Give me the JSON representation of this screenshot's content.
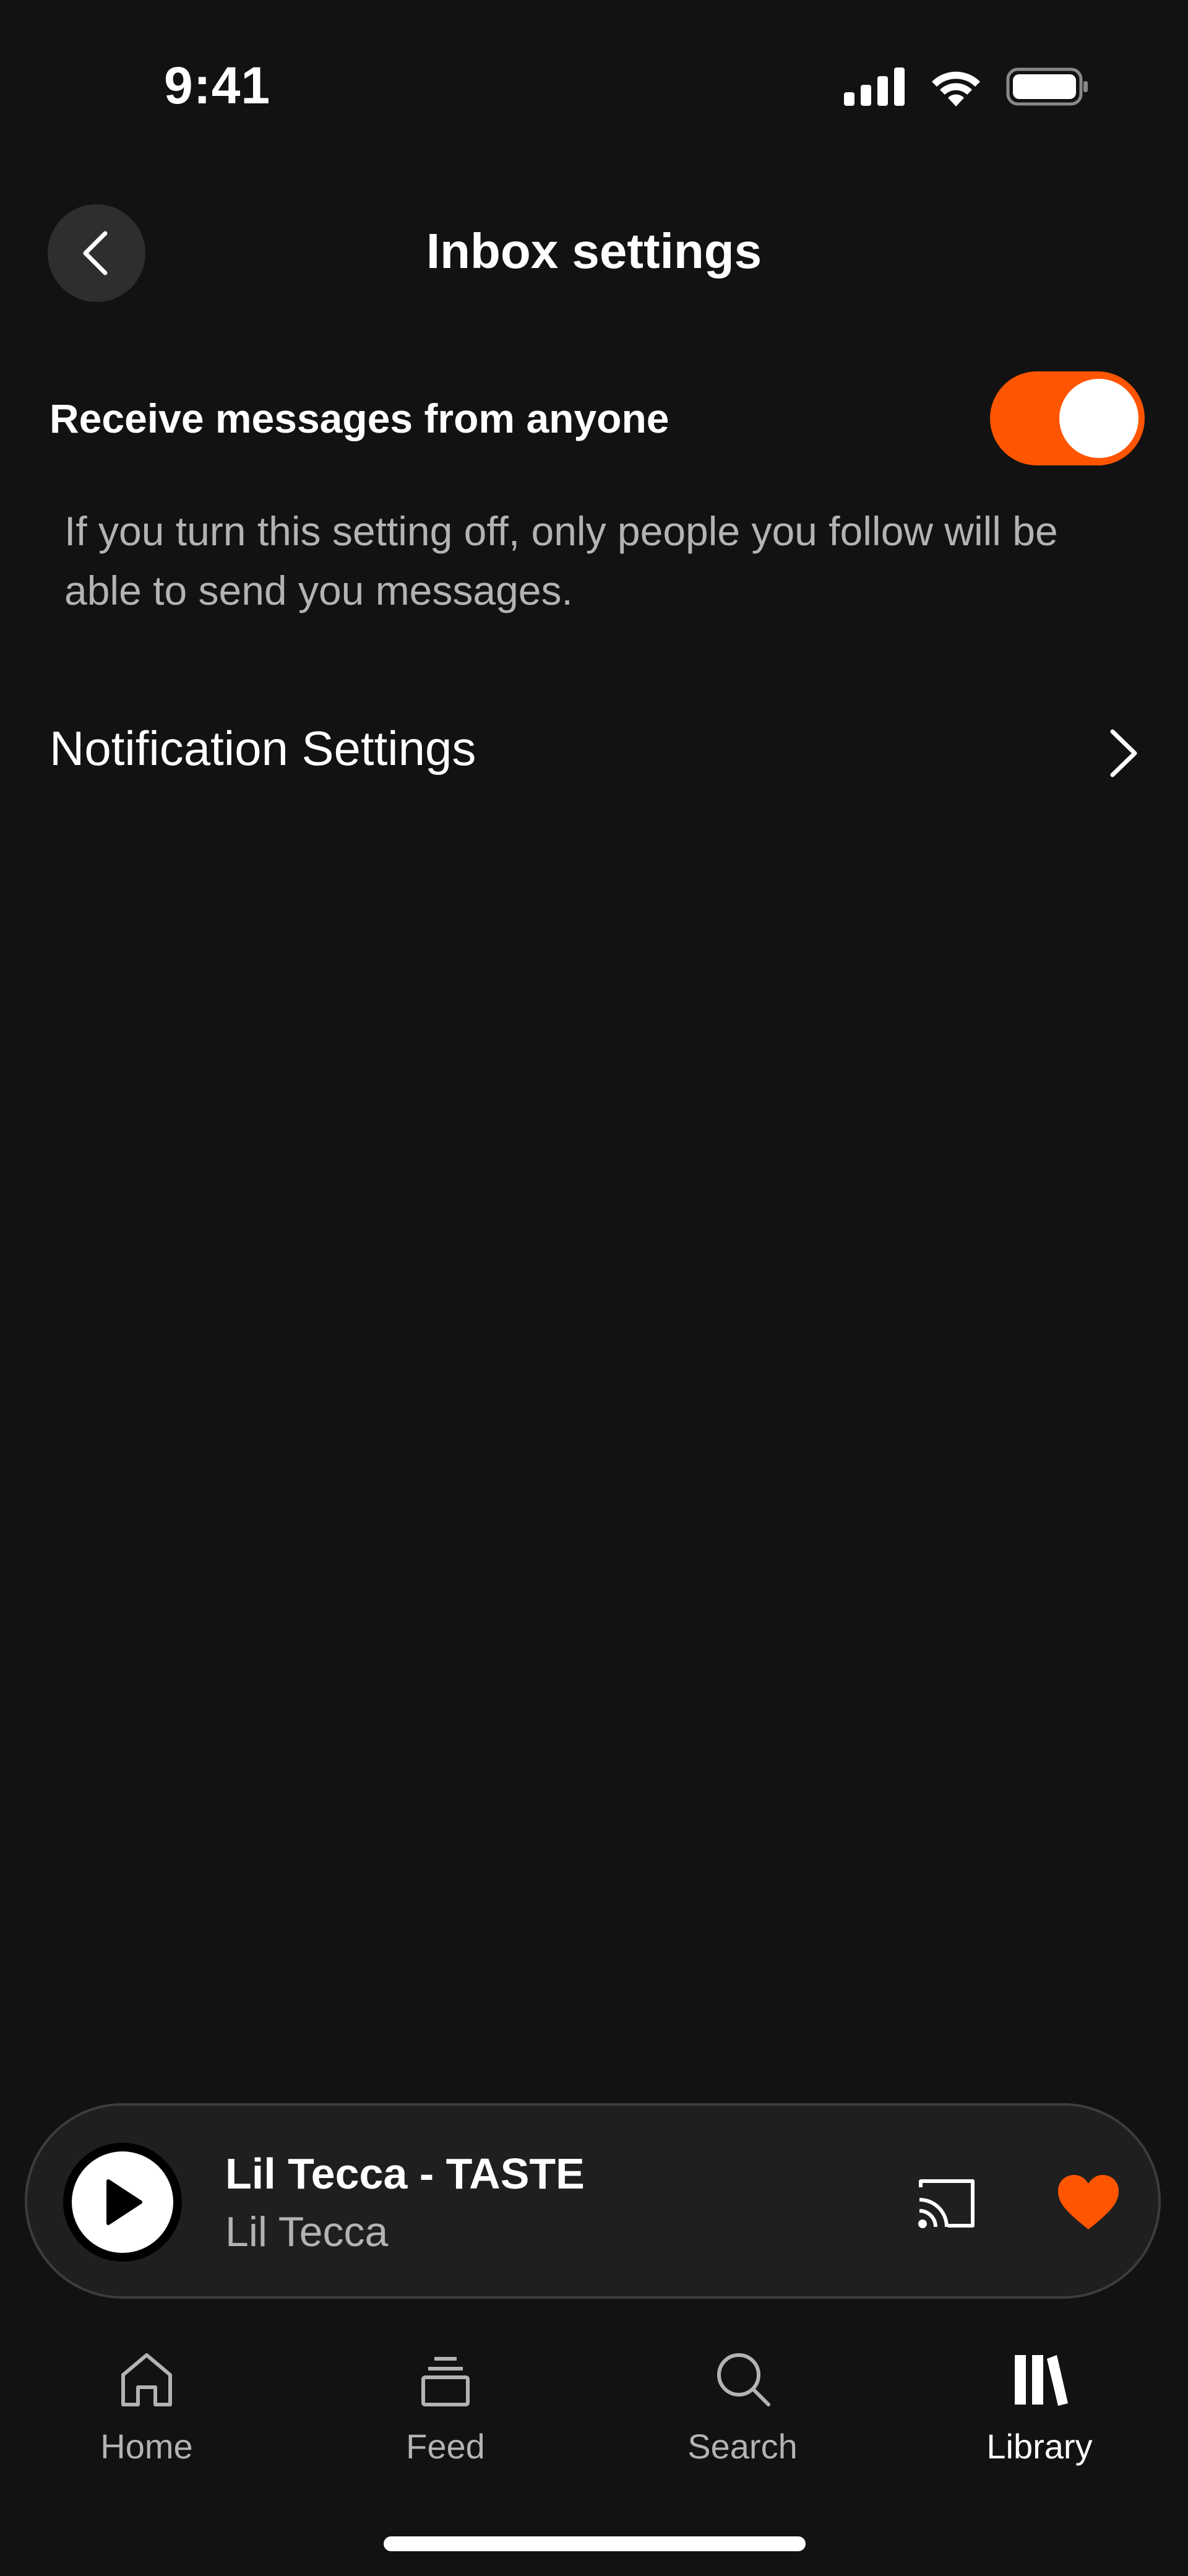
{
  "status_bar": {
    "time": "9:41",
    "icons": [
      "cellular-signal-icon",
      "wifi-icon",
      "battery-icon"
    ]
  },
  "header": {
    "title": "Inbox settings",
    "back_icon": "chevron-left-icon"
  },
  "settings": {
    "receive_messages": {
      "label": "Receive messages from anyone",
      "enabled": true,
      "description": "If you turn this setting off, only people you follow will be able to send you messages."
    },
    "notification_settings": {
      "label": "Notification Settings",
      "icon": "chevron-right-icon"
    }
  },
  "mini_player": {
    "track": "Lil Tecca - TASTE",
    "artist": "Lil Tecca",
    "icons": [
      "play-icon",
      "cast-icon",
      "heart-icon"
    ]
  },
  "tab_bar": {
    "tabs": [
      {
        "label": "Home",
        "icon": "home-icon",
        "active": false
      },
      {
        "label": "Feed",
        "icon": "feed-icon",
        "active": false
      },
      {
        "label": "Search",
        "icon": "search-icon",
        "active": false
      },
      {
        "label": "Library",
        "icon": "library-icon",
        "active": true
      }
    ]
  },
  "colors": {
    "background": "#121212",
    "accent": "#ff5500",
    "secondary_text": "#b3b3b3"
  }
}
